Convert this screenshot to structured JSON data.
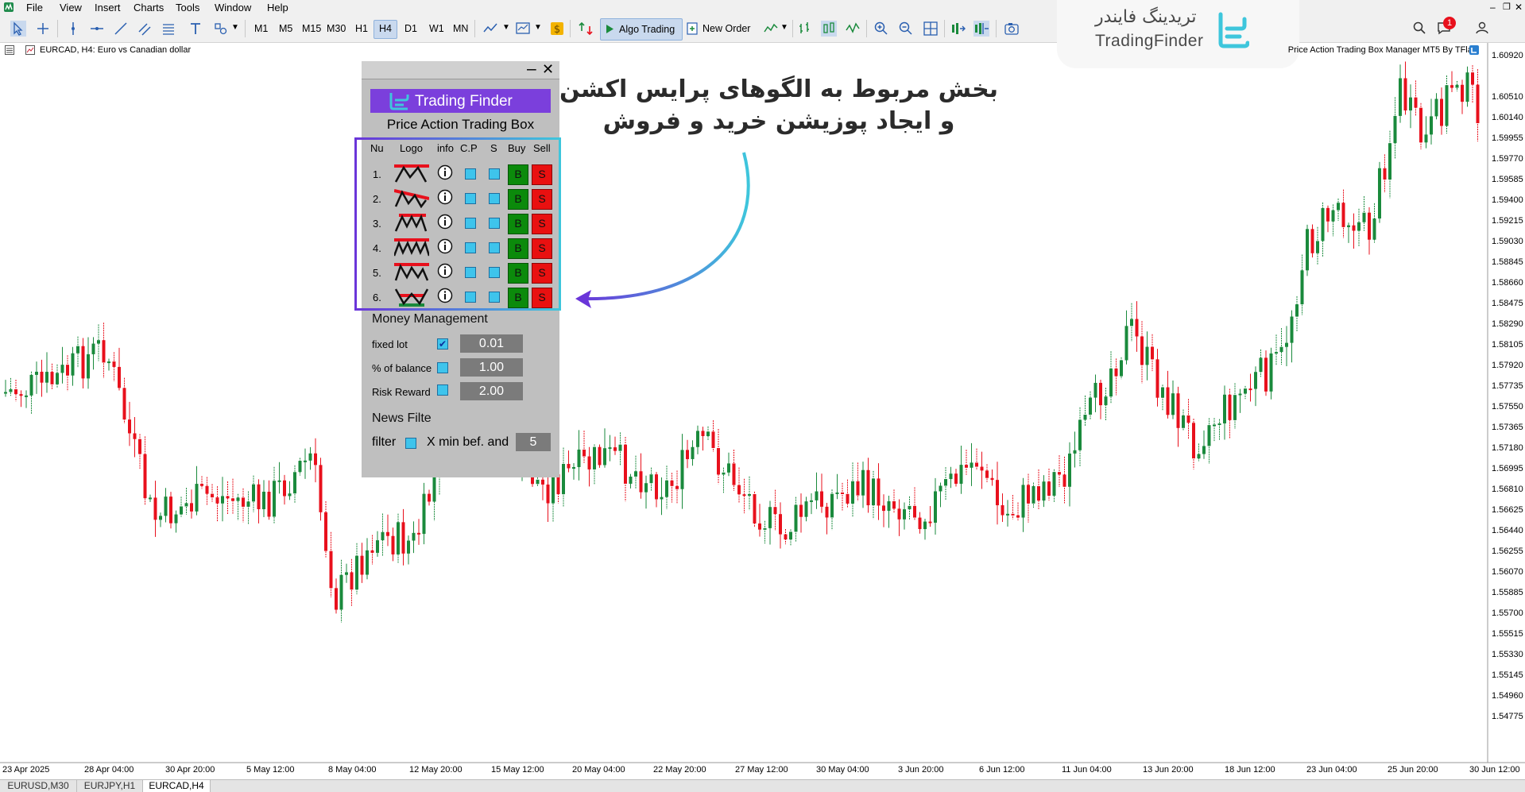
{
  "menu": {
    "items": [
      "File",
      "View",
      "Insert",
      "Charts",
      "Tools",
      "Window",
      "Help"
    ]
  },
  "toolbar": {
    "timeframes": [
      "M1",
      "M5",
      "M15",
      "M30",
      "H1",
      "H4",
      "D1",
      "W1",
      "MN"
    ],
    "active_timeframe": "H4",
    "algo_trading": "Algo Trading",
    "new_order": "New Order"
  },
  "brand": {
    "name_fa": "تریدینگ فایندر",
    "name_en": "TradingFinder",
    "notification_count": "1",
    "accent": "#3ec6dc"
  },
  "chart": {
    "title": "EURCAD, H4:  Euro vs Canadian dollar",
    "caption": "Price Action Trading Box Manager MT5 By TFlab",
    "bull_color": "#1a8a3c",
    "bear_color": "#e8101c",
    "price_labels": [
      "1.60920",
      "1.60510",
      "1.60140",
      "1.59955",
      "1.59770",
      "1.59585",
      "1.59400",
      "1.59215",
      "1.59030",
      "1.58845",
      "1.58660",
      "1.58475",
      "1.58290",
      "1.58105",
      "1.57920",
      "1.57735",
      "1.57550",
      "1.57365",
      "1.57180",
      "1.56995",
      "1.56810",
      "1.56625",
      "1.56440",
      "1.56255",
      "1.56070",
      "1.55885",
      "1.55700",
      "1.55515",
      "1.55330",
      "1.55145",
      "1.54960",
      "1.54775"
    ],
    "date_labels": [
      "23 Apr 2025",
      "28 Apr 04:00",
      "30 Apr 20:00",
      "5 May 12:00",
      "8 May 04:00",
      "12 May 20:00",
      "15 May 12:00",
      "20 May 04:00",
      "22 May 20:00",
      "27 May 12:00",
      "30 May 04:00",
      "3 Jun 20:00",
      "6 Jun 12:00",
      "11 Jun 04:00",
      "13 Jun 20:00",
      "18 Jun 12:00",
      "23 Jun 04:00",
      "25 Jun 20:00",
      "30 Jun 12:00"
    ]
  },
  "tabs": [
    {
      "label": "EURUSD,M30",
      "active": false
    },
    {
      "label": "EURJPY,H1",
      "active": false
    },
    {
      "label": "EURCAD,H4",
      "active": true
    }
  ],
  "panel": {
    "minimize": "–",
    "close": "✕",
    "logo_text": "Trading Finder",
    "title": "Price Action Trading Box",
    "headers": {
      "nu": "Nu",
      "logo": "Logo",
      "info": "info",
      "cp": "C.P",
      "s": "S",
      "buy": "Buy",
      "sell": "Sell"
    },
    "rows": [
      {
        "num": "1.",
        "buy": "B",
        "sell": "S"
      },
      {
        "num": "2.",
        "buy": "B",
        "sell": "S"
      },
      {
        "num": "3.",
        "buy": "B",
        "sell": "S"
      },
      {
        "num": "4.",
        "buy": "B",
        "sell": "S"
      },
      {
        "num": "5.",
        "buy": "B",
        "sell": "S"
      },
      {
        "num": "6.",
        "buy": "B",
        "sell": "S"
      }
    ],
    "money_management": {
      "title": "Money Management",
      "fixed_lot": {
        "label": "fixed lot",
        "checked": true,
        "value": "0.01"
      },
      "percent_balance": {
        "label": "% of balance",
        "checked": false,
        "value": "1.00"
      },
      "risk_reward": {
        "label": "Risk Reward",
        "checked": false,
        "value": "2.00"
      }
    },
    "news_filter": {
      "title": "News Filte",
      "filter_label": "filter",
      "checked": false,
      "text": "X min bef. and",
      "value": "5"
    }
  },
  "annotation": {
    "line1": "بخش مربوط به الگوهای پرایس اکشن",
    "line2": "و ایجاد پوزیشن خرید و فروش"
  }
}
